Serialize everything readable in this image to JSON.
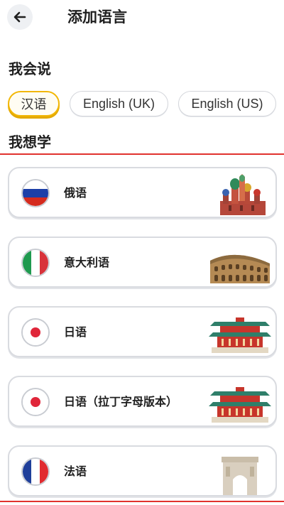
{
  "header": {
    "title": "添加语言",
    "back_icon": "arrow-left-icon"
  },
  "speak_section": {
    "title": "我会说",
    "chips": [
      {
        "label": "汉语",
        "selected": true
      },
      {
        "label": "English (UK)",
        "selected": false
      },
      {
        "label": "English (US)",
        "selected": false
      }
    ]
  },
  "learn_section": {
    "title": "我想学",
    "languages": [
      {
        "name": "俄语",
        "flag": "russia-flag-icon",
        "landmark": "st-basils-cathedral-image"
      },
      {
        "name": "意大利语",
        "flag": "italy-flag-icon",
        "landmark": "colosseum-image"
      },
      {
        "name": "日语",
        "flag": "japan-flag-icon",
        "landmark": "japanese-temple-image"
      },
      {
        "name": "日语（拉丁字母版本）",
        "flag": "japan-flag-icon",
        "landmark": "japanese-temple-image"
      },
      {
        "name": "法语",
        "flag": "france-flag-icon",
        "landmark": "arc-de-triomphe-image"
      }
    ]
  },
  "colors": {
    "accent": "#f2b705",
    "divider_red": "#e1322e"
  }
}
